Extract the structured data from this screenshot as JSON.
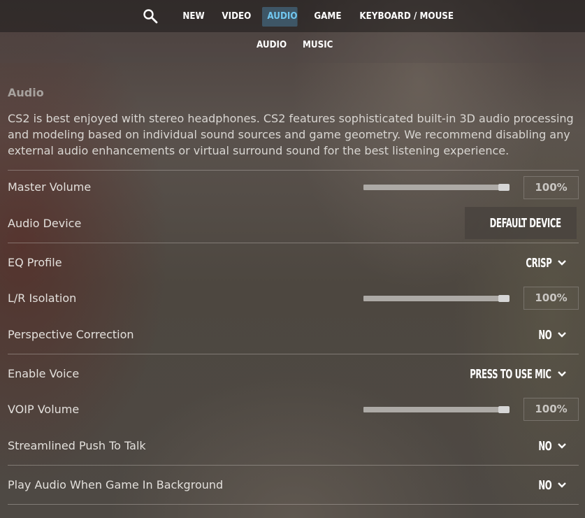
{
  "nav": {
    "search_icon": "search-icon",
    "tabs": [
      {
        "label": "NEW",
        "active": false
      },
      {
        "label": "VIDEO",
        "active": false
      },
      {
        "label": "AUDIO",
        "active": true
      },
      {
        "label": "GAME",
        "active": false
      },
      {
        "label": "KEYBOARD / MOUSE",
        "active": false
      }
    ],
    "subtabs": [
      {
        "label": "AUDIO"
      },
      {
        "label": "MUSIC"
      }
    ]
  },
  "section": {
    "title": "Audio",
    "description": "CS2 is best enjoyed with stereo headphones. CS2 features sophisticated built-in 3D audio processing and modeling based on individual sound sources and game geometry. We recommend disabling any external audio enhancements or virtual surround sound for the best listening experience."
  },
  "settings": [
    {
      "label": "Master Volume",
      "type": "slider",
      "value_fraction": 1.0,
      "value_text": "100%"
    },
    {
      "label": "Audio Device",
      "type": "dropdown",
      "value": "DEFAULT DEVICE",
      "icon": "chevron-down-icon"
    },
    {
      "label": "EQ Profile",
      "type": "dropdown",
      "value": "CRISP",
      "icon": "chevron-down-icon"
    },
    {
      "label": "L/R Isolation",
      "type": "slider",
      "value_fraction": 1.0,
      "value_text": "100%"
    },
    {
      "label": "Perspective Correction",
      "type": "dropdown",
      "value": "NO",
      "icon": "chevron-down-icon"
    },
    {
      "label": "Enable Voice",
      "type": "dropdown",
      "value": "PRESS TO USE MIC",
      "icon": "chevron-down-icon"
    },
    {
      "label": "VOIP Volume",
      "type": "slider",
      "value_fraction": 1.0,
      "value_text": "100%"
    },
    {
      "label": "Streamlined Push To Talk",
      "type": "dropdown",
      "value": "NO",
      "icon": "chevron-down-icon"
    },
    {
      "label": "Play Audio When Game In Background",
      "type": "dropdown",
      "value": "NO",
      "icon": "chevron-down-icon"
    }
  ],
  "colors": {
    "active_tab_bg": "#3e5666",
    "active_tab_text": "#71c7f0",
    "text_primary": "#ffffff",
    "label_text": "#e3e0dc",
    "slider_track": "#adaaa6"
  }
}
